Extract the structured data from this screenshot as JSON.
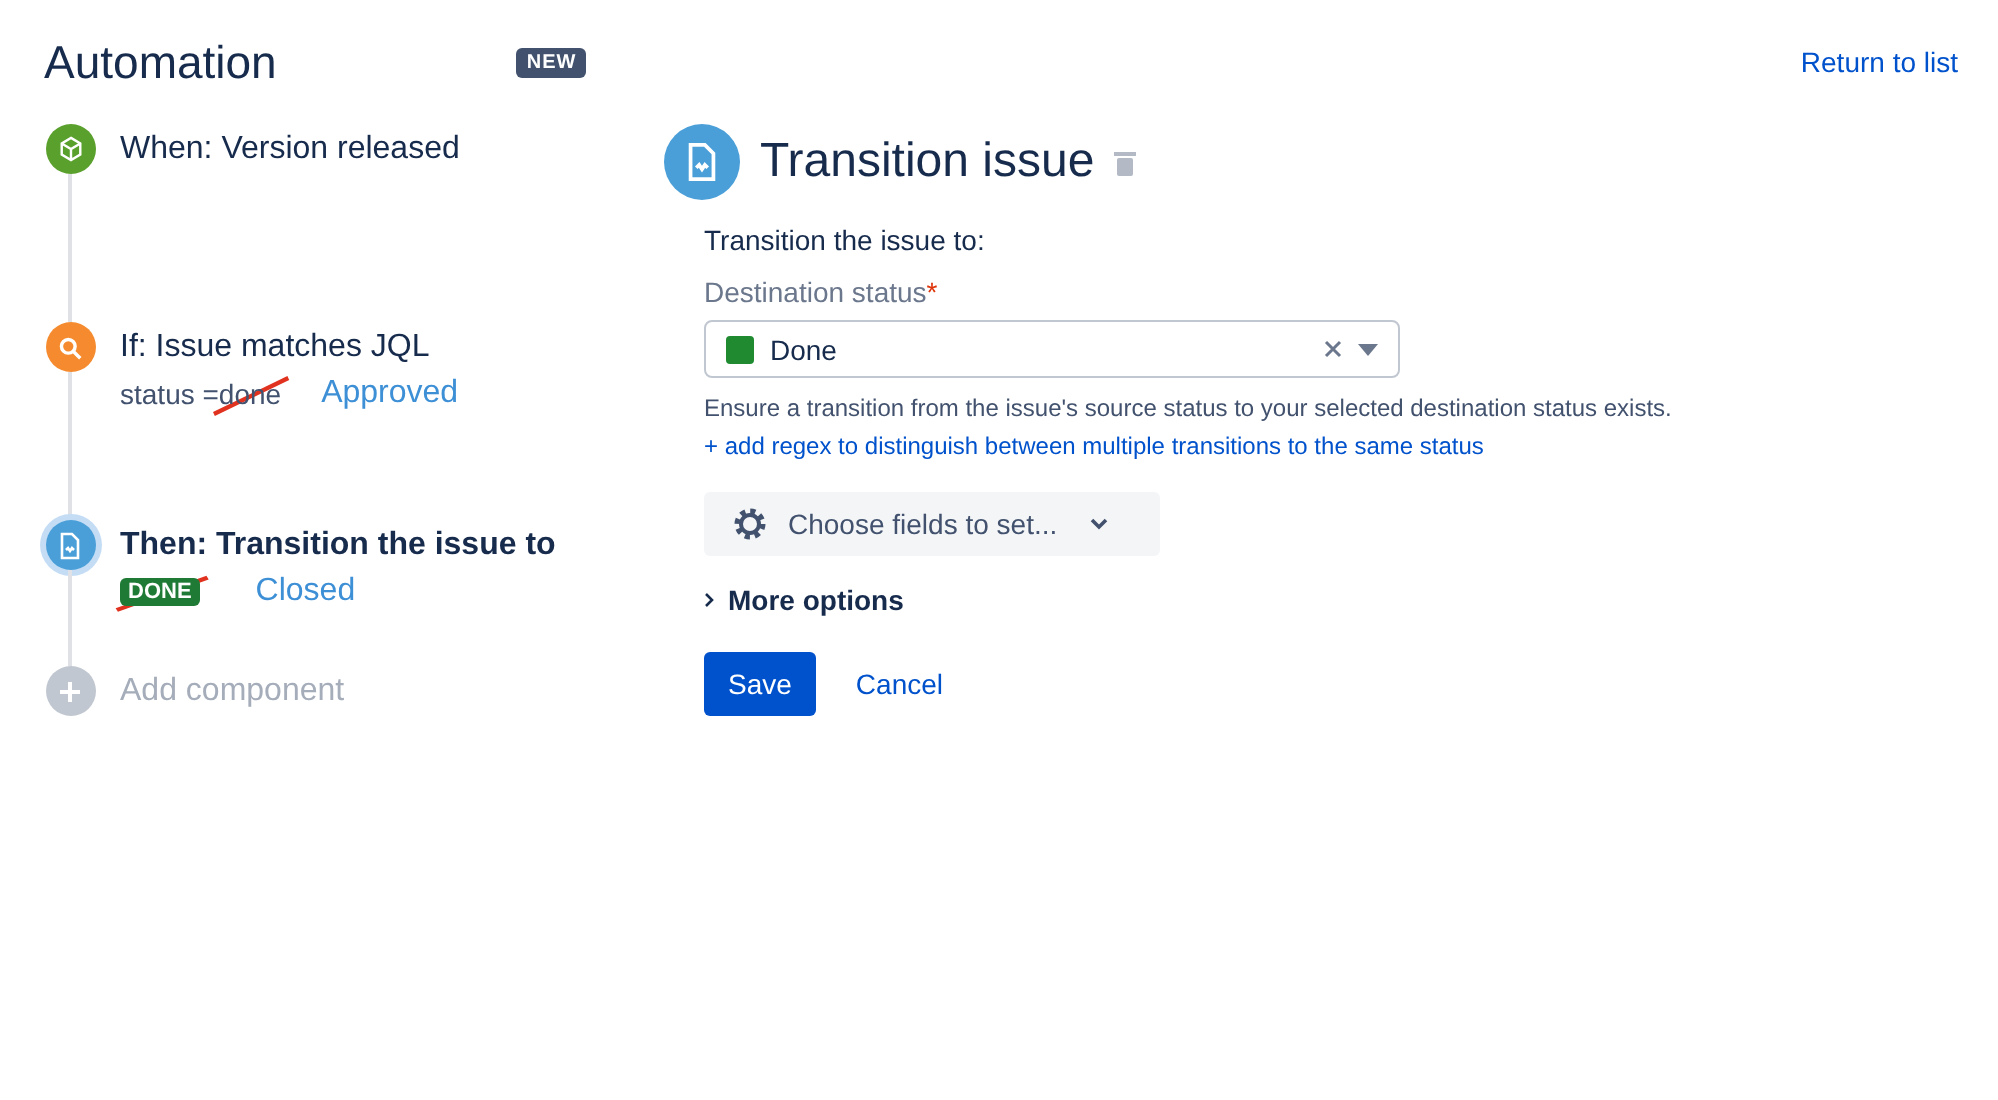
{
  "header": {
    "title": "Automation",
    "badge": "NEW",
    "return_link": "Return to list"
  },
  "steps": [
    {
      "kind": "trigger",
      "title": "When: Version released",
      "selected": false
    },
    {
      "kind": "condition",
      "title": "If: Issue matches JQL",
      "detail": "status = ",
      "value": "done",
      "struck_out": true,
      "note": "Approved",
      "selected": false
    },
    {
      "kind": "action",
      "title": "Then: Transition the issue to",
      "lozenge": "DONE",
      "struck_out": true,
      "note": "Closed",
      "selected": true
    },
    {
      "kind": "add",
      "title": "Add component",
      "selected": false
    }
  ],
  "panel": {
    "title": "Transition issue",
    "section_label": "Transition the issue to:",
    "field_label": "Destination status",
    "required_mark": "*",
    "select": {
      "value": "Done",
      "color": "#1f8a2f"
    },
    "help": "Ensure a transition from the issue's source status to your selected destination status exists.",
    "regex_link": "+ add regex to distinguish between multiple transitions to the same status",
    "fields_button": "Choose fields to set...",
    "more_options": "More options",
    "expanded": false,
    "buttons": [
      {
        "kind": "primary",
        "label": "Save"
      },
      {
        "kind": "link",
        "label": "Cancel"
      }
    ]
  }
}
